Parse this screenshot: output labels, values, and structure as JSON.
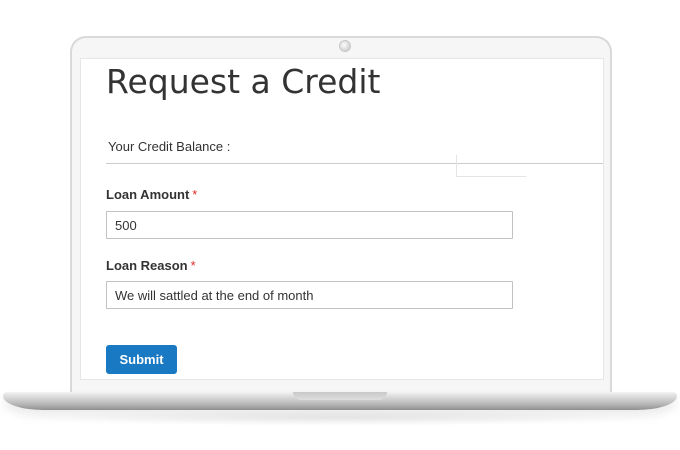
{
  "page": {
    "title": "Request a Credit"
  },
  "balance": {
    "label": "Your Credit Balance :"
  },
  "form": {
    "loan_amount": {
      "label": "Loan Amount",
      "required_mark": "*",
      "value": "500"
    },
    "loan_reason": {
      "label": "Loan Reason",
      "required_mark": "*",
      "value": "We will sattled at the end of month"
    },
    "submit_label": "Submit"
  },
  "colors": {
    "accent": "#1979c3",
    "required": "#e02b27",
    "text": "#333333"
  }
}
